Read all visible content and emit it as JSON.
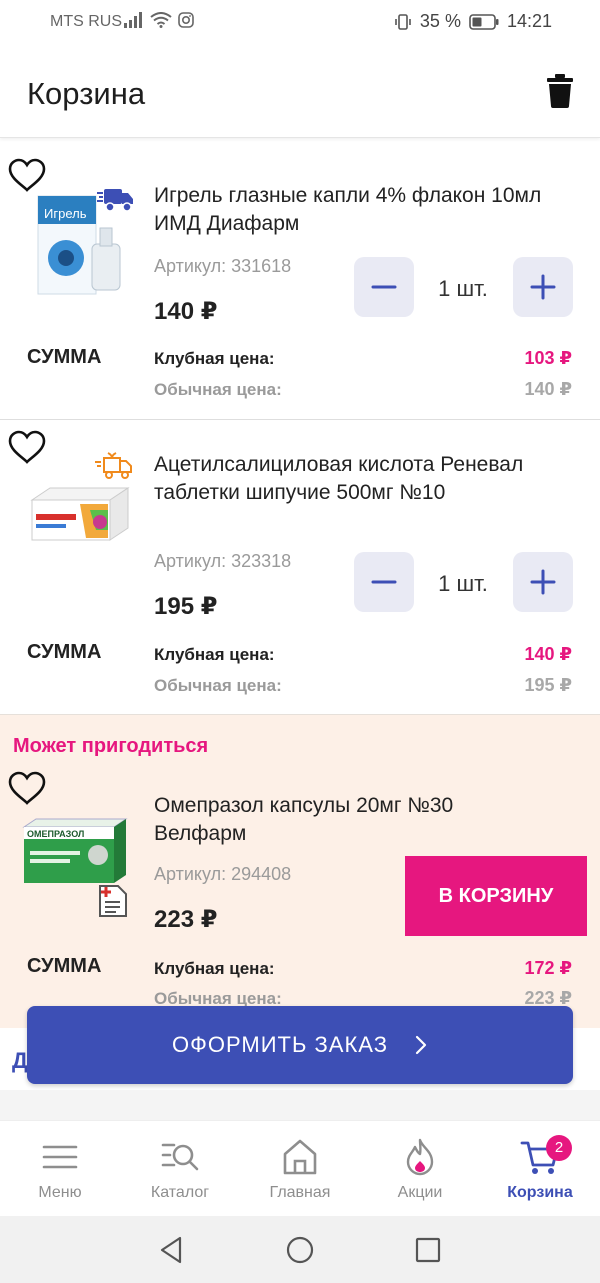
{
  "status_bar": {
    "carrier": "MTS RUS",
    "battery": "35 %",
    "time": "14:21"
  },
  "header": {
    "title": "Корзина",
    "delete_icon": "trash-icon"
  },
  "cart": {
    "items": [
      {
        "name": "Игрель глазные капли 4% флакон 10мл ИМД Диафарм",
        "sku": "Артикул: 331618",
        "price": "140 ₽",
        "quantity": "1 шт.",
        "sum_label": "СУММА",
        "club_label": "Клубная цена:",
        "club_price": "103 ₽",
        "regular_label": "Обычная цена:",
        "regular_price": "140 ₽",
        "badge_icon": "delivery-truck-icon",
        "image_text": "Игрель"
      },
      {
        "name": "Ацетилсалициловая кислота Реневал таблетки шипучие 500мг №10",
        "sku": "Артикул: 323318",
        "price": "195 ₽",
        "quantity": "1 шт.",
        "sum_label": "СУММА",
        "club_label": "Клубная цена:",
        "club_price": "140 ₽",
        "regular_label": "Обычная цена:",
        "regular_price": "195 ₽",
        "badge_icon": "gift-delivery-icon"
      }
    ]
  },
  "suggestion": {
    "title": "Может пригодиться",
    "item": {
      "name": "Омепразол капсулы 20мг №30 Велфарм",
      "sku": "Артикул: 294408",
      "price": "223 ₽",
      "add_button": "В КОРЗИНУ",
      "sum_label": "СУММА",
      "club_label": "Клубная цена:",
      "club_price": "172 ₽",
      "regular_label": "Обычная цена:",
      "regular_price": "223 ₽",
      "badge_icon": "prescription-icon",
      "image_text": "ОМЕПРАЗОЛ"
    }
  },
  "order_button": {
    "label": "ОФОРМИТЬ ЗАКАЗ",
    "peek_letter": "Д"
  },
  "bottom_nav": {
    "items": [
      {
        "label": "Меню",
        "icon": "menu-icon"
      },
      {
        "label": "Каталог",
        "icon": "catalog-search-icon"
      },
      {
        "label": "Главная",
        "icon": "home-icon"
      },
      {
        "label": "Акции",
        "icon": "flame-icon"
      },
      {
        "label": "Корзина",
        "icon": "cart-icon",
        "badge": "2",
        "active": true
      }
    ]
  },
  "colors": {
    "accent": "#3d4fb5",
    "pink": "#e6177f",
    "suggest_bg": "#fdf0e7"
  }
}
